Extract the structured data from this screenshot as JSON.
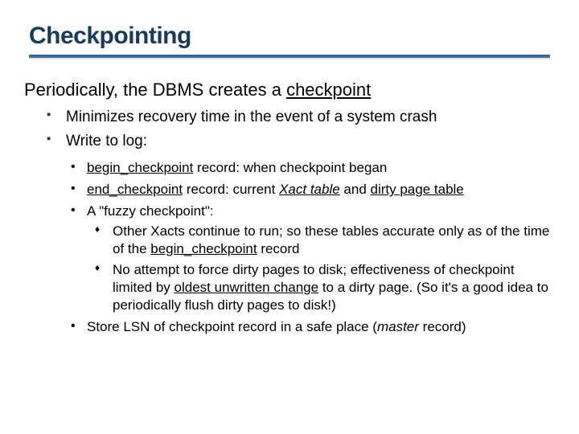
{
  "title": "Checkpointing",
  "lead": {
    "prefix": "Periodically, the DBMS creates a ",
    "underlined": "checkpoint"
  },
  "l1": [
    {
      "text": "Minimizes recovery time in the event of a system crash"
    },
    {
      "text": "Write to log:"
    }
  ],
  "l2": {
    "begin": {
      "term": "begin_checkpoint",
      "rest": " record:  when checkpoint began"
    },
    "end": {
      "term": "end_checkpoint",
      "mid": " record:  current ",
      "xact": "Xact table",
      "and": " and ",
      "dirty": "dirty page table"
    },
    "fuzzy": "A \"fuzzy checkpoint\":",
    "store": {
      "pre": "Store LSN of checkpoint record in a safe place (",
      "master": "master",
      "post": " record)"
    }
  },
  "l3": {
    "a": {
      "pre": "Other Xacts continue to run; so these tables accurate only as of the time of the ",
      "term": "begin_checkpoint",
      "post": " record"
    },
    "b": {
      "pre": "No attempt to force dirty pages to disk; effectiveness of checkpoint limited by ",
      "u": "oldest unwritten change",
      "post": " to a dirty page. (So it's a good idea to periodically flush dirty pages to disk!)"
    }
  }
}
